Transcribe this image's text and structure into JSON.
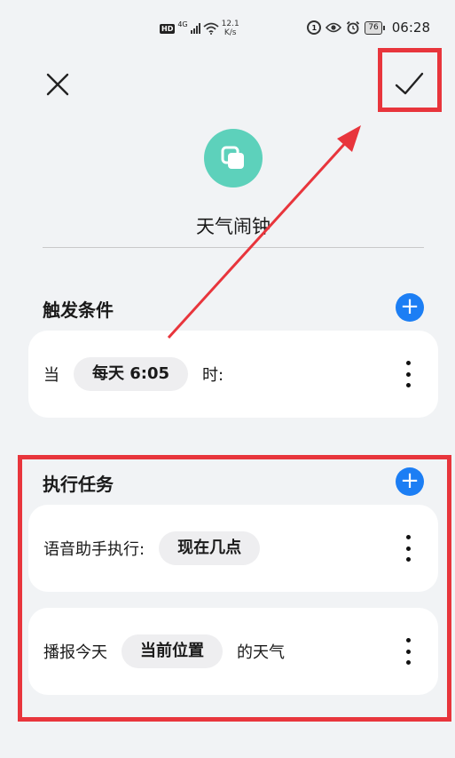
{
  "status_bar": {
    "hd": "HD",
    "network": "4G",
    "speed_value": "12.1",
    "speed_unit": "K/s",
    "battery": "76",
    "time": "06:28"
  },
  "header": {
    "app_name": "天气闹钟"
  },
  "trigger": {
    "title": "触发条件",
    "prefix": "当",
    "chip": "每天 6:05",
    "suffix": "时:"
  },
  "tasks": {
    "title": "执行任务",
    "items": [
      {
        "prefix": "语音助手执行:",
        "chip": "现在几点",
        "suffix": ""
      },
      {
        "prefix": "播报今天",
        "chip": "当前位置",
        "suffix": "的天气"
      }
    ]
  },
  "annotation_color": "#e8353c",
  "accent_color": "#1c7ef4",
  "app_icon_color": "#5dd1bb"
}
